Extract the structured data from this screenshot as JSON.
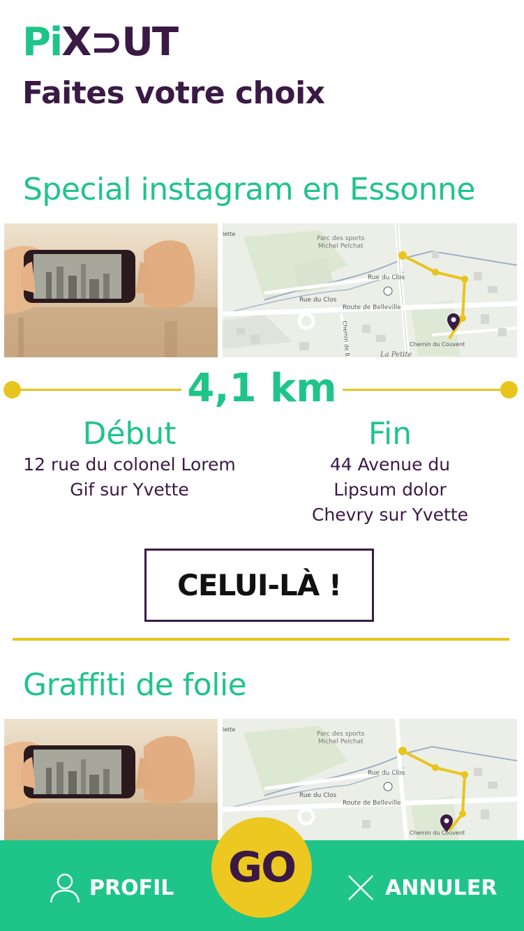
{
  "header": {
    "logo_pi": "Pi",
    "logo_xout": "X⊃UT",
    "title": "Faites votre choix"
  },
  "routes": [
    {
      "title": "Special instagram en Essonne",
      "distance": "4,1 km",
      "start": {
        "label": "Début",
        "line1": "12 rue du colonel Lorem",
        "line2": "Gif sur Yvette"
      },
      "end": {
        "label": "Fin",
        "line1": "44 Avenue du",
        "line2": "Lipsum dolor",
        "line3": "Chevry sur Yvette"
      },
      "select_label": "CELUI-LÀ !",
      "map": {
        "park_label_1": "Parc des sports",
        "park_label_2": "Michel Pelchat",
        "road_1": "Rue du Clos",
        "road_2": "Rue du Clos",
        "road_3": "Route de Belleville",
        "road_4": "Chemin du Couvent",
        "road_5": "Chemin de B",
        "road_6": "La Petite",
        "road_7": "lette"
      }
    },
    {
      "title": "Graffiti de folie",
      "map": {
        "park_label_1": "Parc des sports",
        "park_label_2": "Michel Pelchat",
        "road_1": "Rue du Clos",
        "road_2": "Rue du Clos",
        "road_3": "Route de Belleville",
        "road_4": "Chemin du Couvent",
        "road_7": "lette"
      }
    }
  ],
  "bottom_nav": {
    "profile_label": "PROFIL",
    "go_label": "GO",
    "cancel_label": "ANNULER"
  },
  "colors": {
    "brand_green": "#1fc489",
    "brand_purple": "#3a1a45",
    "accent_yellow": "#e8c51c"
  },
  "icons": {
    "profile": "person-icon",
    "cancel": "close-icon",
    "route_end": "map-pin-icon"
  }
}
